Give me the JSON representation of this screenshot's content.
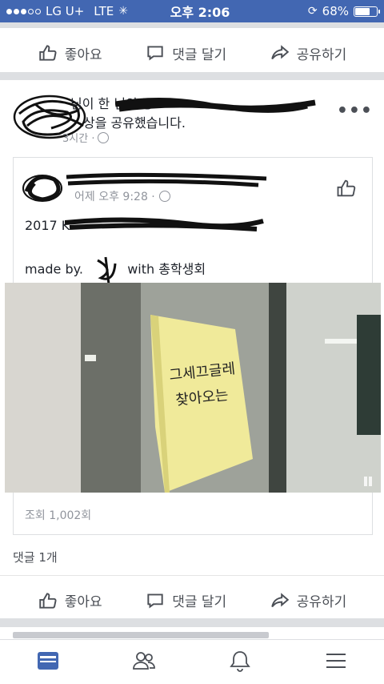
{
  "status_bar": {
    "carrier": "LG U+",
    "network": "LTE",
    "time": "오후 2:06",
    "battery_percent": "68%",
    "battery_level": 0.68
  },
  "actions_top": {
    "like": "좋아요",
    "comment": "댓글 달기",
    "share": "공유하기"
  },
  "post": {
    "header_text": "님이 님의 동영상을 공유했습니다.",
    "header_line1_visible": "님이 한 님의 동",
    "header_line2_visible": "상을 공유했습니다.",
    "time": "3시간 ·",
    "more": "•••",
    "shared": {
      "time": "어제 오후 9:28 ·",
      "line1": "2017 K",
      "line2_prefix": "made by. ",
      "line2_suffix": "with 총학생회",
      "note_text": "그세끄글레 찾아오는",
      "views": "조회 1,002회"
    },
    "comment_count": "댓글 1개"
  },
  "actions_bottom": {
    "like": "좋아요",
    "comment": "댓글 달기",
    "share": "공유하기"
  },
  "icons": {
    "like": "thumbs-up-icon",
    "comment": "speech-bubble-icon",
    "share": "share-arrow-icon",
    "feed": "news-feed-icon",
    "friends": "friends-icon",
    "notifications": "bell-icon",
    "menu": "hamburger-menu-icon"
  },
  "colors": {
    "facebook_blue": "#4267b2",
    "feed_active": "#4267b2",
    "text_secondary": "#90949c"
  }
}
